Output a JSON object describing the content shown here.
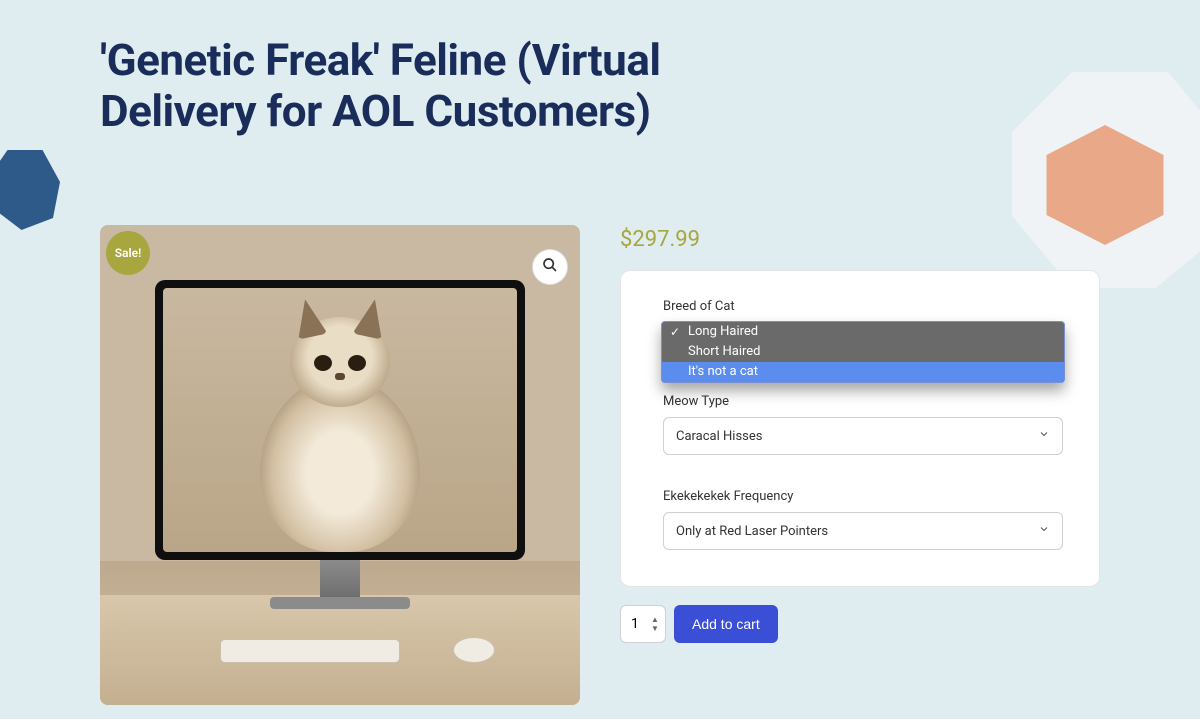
{
  "title": "'Genetic Freak' Feline (Virtual Delivery for AOL Customers)",
  "sale_badge": "Sale!",
  "price": "$297.99",
  "fields": {
    "breed": {
      "label": "Breed of Cat",
      "options": [
        "Long Haired",
        "Short Haired",
        "It's not a cat"
      ],
      "selected": "Long Haired",
      "highlighted": "It's not a cat"
    },
    "meow": {
      "label": "Meow Type",
      "value": "Caracal Hisses"
    },
    "freq": {
      "label": "Ekekekekek Frequency",
      "value": "Only at Red Laser Pointers"
    }
  },
  "quantity": "1",
  "add_to_cart": "Add to cart"
}
